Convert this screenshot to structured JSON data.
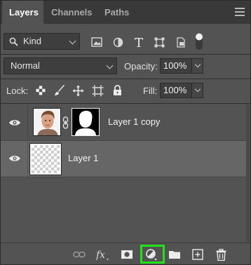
{
  "tabs": [
    {
      "label": "Layers"
    },
    {
      "label": "Channels"
    },
    {
      "label": "Paths"
    }
  ],
  "filter": {
    "kind_label": "Kind"
  },
  "blend": {
    "mode": "Normal",
    "opacity_label": "Opacity:",
    "opacity_value": "100%"
  },
  "lock": {
    "label": "Lock:",
    "fill_label": "Fill:",
    "fill_value": "100%"
  },
  "layers": [
    {
      "name": "Layer 1 copy",
      "visible": true,
      "has_mask": true,
      "selected": false
    },
    {
      "name": "Layer 1",
      "visible": true,
      "has_mask": false,
      "selected": true
    }
  ],
  "colors": {
    "highlight": "#22e01a",
    "panel": "#535353",
    "selected_row": "#666666"
  }
}
